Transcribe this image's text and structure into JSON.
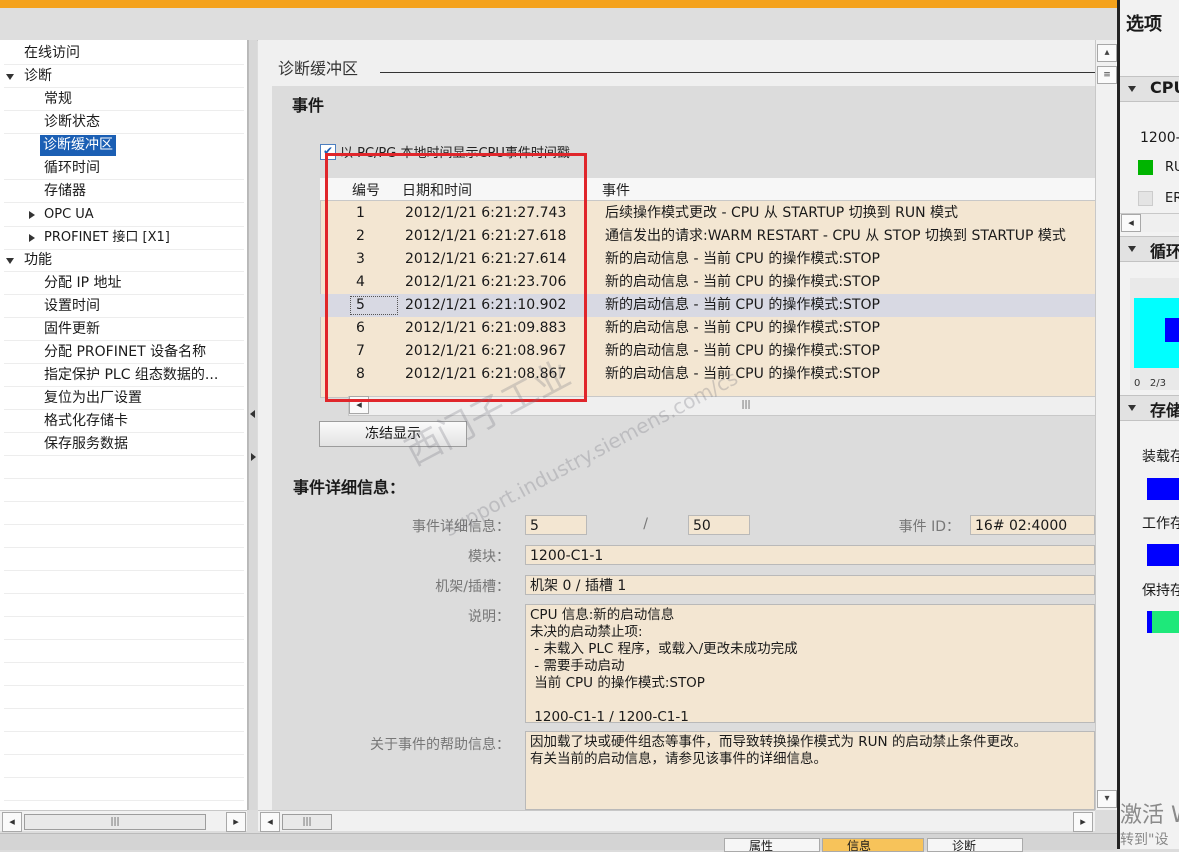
{
  "nav": {
    "items": [
      {
        "label": "在线访问"
      },
      {
        "label": "诊断"
      },
      {
        "label": "常规"
      },
      {
        "label": "诊断状态"
      },
      {
        "label": "诊断缓冲区"
      },
      {
        "label": "循环时间"
      },
      {
        "label": "存储器"
      },
      {
        "label": "OPC UA"
      },
      {
        "label": "PROFINET 接口 [X1]"
      },
      {
        "label": "功能"
      },
      {
        "label": "分配 IP 地址"
      },
      {
        "label": "设置时间"
      },
      {
        "label": "固件更新"
      },
      {
        "label": "分配 PROFINET 设备名称"
      },
      {
        "label": "指定保护 PLC 组态数据的..."
      },
      {
        "label": "复位为出厂设置"
      },
      {
        "label": "格式化存储卡"
      },
      {
        "label": "保存服务数据"
      }
    ]
  },
  "main": {
    "section_title": "诊断缓冲区",
    "events_heading": "事件",
    "checkbox_label": "以 PC/PG 本地时间显示CPU事件时间戳",
    "table": {
      "headers": {
        "num": "编号",
        "datetime": "日期和时间",
        "event": "事件"
      },
      "rows": [
        {
          "num": "1",
          "datetime": "2012/1/21 6:21:27.743",
          "event": "后续操作模式更改  - CPU 从 STARTUP 切换到 RUN 模式"
        },
        {
          "num": "2",
          "datetime": "2012/1/21 6:21:27.618",
          "event": "通信发出的请求:WARM RESTART  - CPU 从 STOP 切换到 STARTUP 模式"
        },
        {
          "num": "3",
          "datetime": "2012/1/21 6:21:27.614",
          "event": "新的启动信息 - 当前 CPU 的操作模式:STOP"
        },
        {
          "num": "4",
          "datetime": "2012/1/21 6:21:23.706",
          "event": "新的启动信息 - 当前 CPU 的操作模式:STOP"
        },
        {
          "num": "5",
          "datetime": "2012/1/21 6:21:10.902",
          "event": "新的启动信息 - 当前 CPU 的操作模式:STOP"
        },
        {
          "num": "6",
          "datetime": "2012/1/21 6:21:09.883",
          "event": "新的启动信息 - 当前 CPU 的操作模式:STOP"
        },
        {
          "num": "7",
          "datetime": "2012/1/21 6:21:08.967",
          "event": "新的启动信息 - 当前 CPU 的操作模式:STOP"
        },
        {
          "num": "8",
          "datetime": "2012/1/21 6:21:08.867",
          "event": "新的启动信息 - 当前 CPU 的操作模式:STOP"
        }
      ]
    },
    "freeze_button": "冻结显示",
    "detail_title": "事件详细信息：",
    "details": {
      "event_detail_label": "事件详细信息：",
      "event_index": "5",
      "separator": "/",
      "event_total": "50",
      "event_id_label": "事件 ID：",
      "event_id": "16# 02:4000",
      "module_label": "模块：",
      "module": "1200-C1-1",
      "rack_label": "机架/插槽：",
      "rack": "机架 0 / 插槽 1",
      "desc_label": "说明：",
      "description": "CPU 信息:新的启动信息\n未决的启动禁止项:\n - 未载入 PLC 程序，或载入/更改未成功完成\n - 需要手动启动\n 当前 CPU 的操作模式:STOP\n\n 1200-C1-1 / 1200-C1-1",
      "help_label": "关于事件的帮助信息：",
      "help_text": "因加载了块或硬件组态等事件，而导致转换操作模式为 RUN 的启动禁止条件更改。\n有关当前的启动信息，请参见该事件的详细信息。"
    },
    "watermark": {
      "line1": "西门子工业",
      "line2": "support.industry.siemens.com/cs"
    }
  },
  "right_panel": {
    "title": "选项",
    "cpu_section": "CPU",
    "cpu_name": "1200-",
    "run_label": "RU",
    "error_label": "ER",
    "cycle_section": "循环",
    "cycle_axis": "0   2/3",
    "memory_section": "存储",
    "load_label": "装载存",
    "work_label": "工作存",
    "retain_label": "保持存",
    "activate_text": "激活 W",
    "goto_text": "转到\"设"
  },
  "bottom_tabs": [
    {
      "label": "属性"
    },
    {
      "label": "信息"
    },
    {
      "label": "诊断"
    }
  ],
  "colors": {
    "accent": "#f4a21c",
    "selected": "#1b5fb4",
    "highlight_box": "#e0262b",
    "field_bg": "#f3e6d2",
    "run_green": "#00b400"
  }
}
